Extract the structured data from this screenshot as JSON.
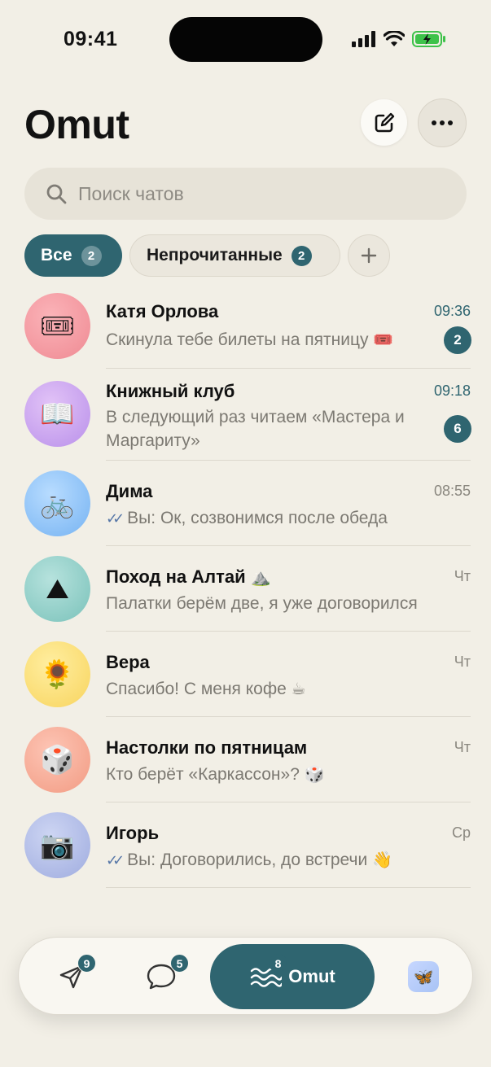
{
  "status_bar": {
    "time": "09:41"
  },
  "header": {
    "title": "Omut"
  },
  "search": {
    "placeholder": "Поиск чатов"
  },
  "filters": {
    "all": {
      "label": "Все",
      "count": "2"
    },
    "unread": {
      "label": "Непрочитанные",
      "count": "2"
    }
  },
  "chats": [
    {
      "name": "Катя Орлова",
      "message": "Скинула тебе билеты на пятницу",
      "message_emoji": "🎟️",
      "time": "09:36",
      "unread": "2",
      "avatar_icon": "ticket-icon",
      "avatar_emoji": "🎟"
    },
    {
      "name": "Книжный клуб",
      "message": "В следующий раз читаем «Мастера и Маргариту»",
      "time": "09:18",
      "unread": "6",
      "avatar_icon": "book-icon",
      "avatar_emoji": "📖"
    },
    {
      "name": "Дима",
      "message": "Вы: Ок, созвонимся после обеда",
      "time": "08:55",
      "avatar_icon": "bicycle-icon",
      "avatar_emoji": "🚲"
    },
    {
      "name": "Поход на Алтай",
      "name_emoji": "⛰️",
      "message": "Палатки берём две, я уже договорился",
      "time": "Чт",
      "avatar_icon": "mountain-icon",
      "avatar_emoji": "⛰"
    },
    {
      "name": "Вера",
      "message": "Спасибо! С меня кофе",
      "message_emoji": "☕",
      "time": "Чт",
      "avatar_icon": "sunflower-icon",
      "avatar_emoji": "🌻"
    },
    {
      "name": "Настолки по пятницам",
      "message": "Кто берёт «Каркассон»?",
      "message_emoji": "🎲",
      "time": "Чт",
      "avatar_icon": "dice-icon",
      "avatar_emoji": "🎲"
    },
    {
      "name": "Игорь",
      "message": "Вы: Договорились, до встречи",
      "message_emoji": "👋",
      "time": "Ср",
      "avatar_icon": "camera-icon",
      "avatar_emoji": "📷"
    }
  ],
  "tabbar": {
    "send_badge": "9",
    "chats_badge": "5",
    "omut_badge": "8",
    "omut_label": "Omut",
    "profile_icon": "butterfly-icon",
    "profile_emoji": "🦋"
  },
  "colors": {
    "accent": "#2f6570",
    "background": "#f2efe6"
  }
}
